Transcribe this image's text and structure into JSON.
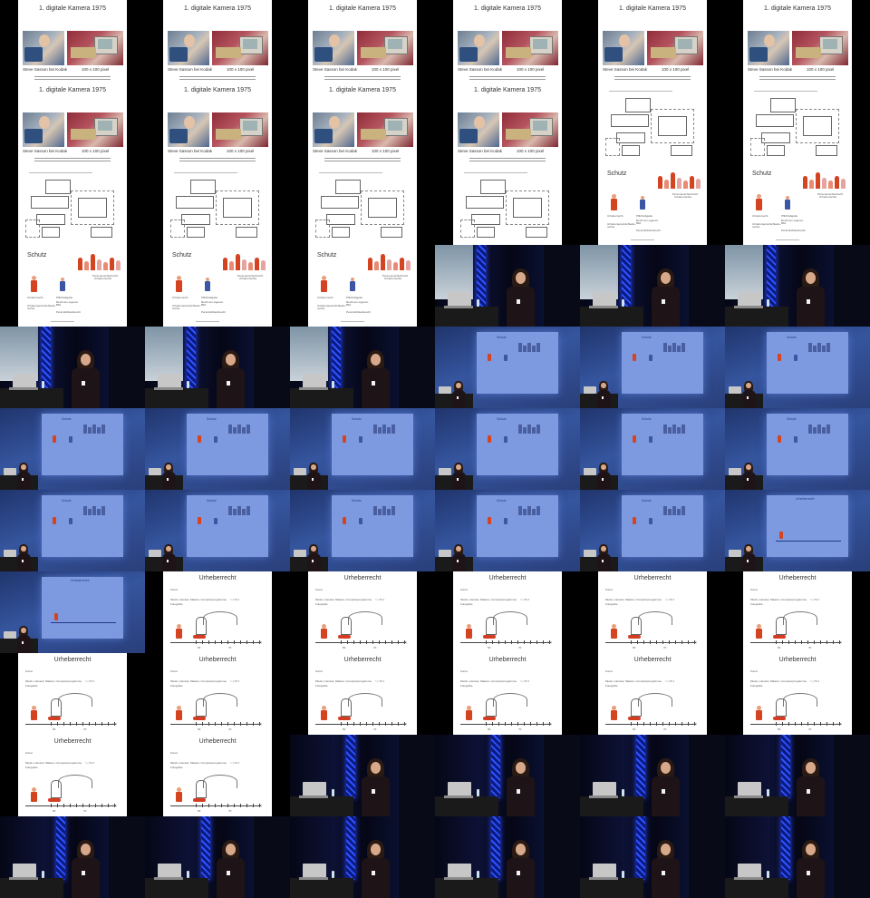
{
  "sheet": {
    "title": "",
    "rows": 11,
    "cols": 6
  },
  "camera_slide": {
    "title": "1. digitale Kamera 1975",
    "left_caption": "Steve Sasson bei Kodak",
    "right_caption": "100 x 100 pixel",
    "footnote_lines": [
      "",
      ""
    ]
  },
  "schutz_slide": {
    "title": "Schutz",
    "labels": {
      "urheberrecht": "Urheberrecht",
      "urheberpersoenlichkeit": "Urheberpersönlichkeits-rechte",
      "urheberpersoenlichkeit_l1": "Urheberpersönlichkeits-",
      "urheberpersoenlichkeit_l2": "rechte",
      "pflichtabgabe": "Pflichtabgabe",
      "recht_am_bild": "Recht am eigenen Bild",
      "recht_am_bild_l1": "Recht am eigenen",
      "recht_am_bild_l2": "Bild",
      "persoenlichkeit": "Persönlichkeitsrecht",
      "personenschutz": "Personenschutzrecht",
      "personenschutz_l2": "Urheberrechte"
    }
  },
  "urheber_slide": {
    "title": "Urheberrecht",
    "sub_label": "Kunst",
    "line1": "Musik, Literatur, Malerei, Computerprogramme",
    "line1_right": "> | 70 J",
    "line2": "Fotografie",
    "axis_end": "t (J)",
    "tick_a": "50",
    "tick_b": "70"
  },
  "colors": {
    "red_figure": "#d54421",
    "blue_figure": "#3a56a5",
    "truss": "#2d53ff",
    "projection": "#7d99e0"
  }
}
